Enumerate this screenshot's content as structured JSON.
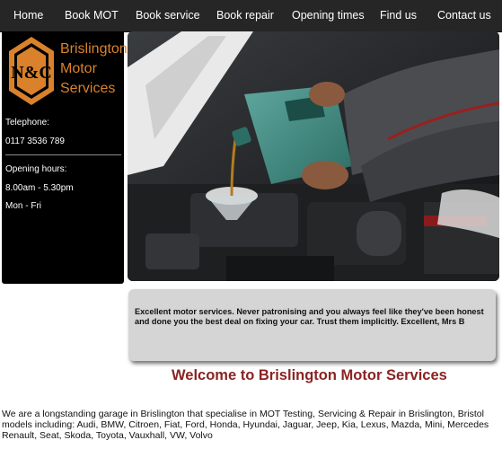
{
  "nav": {
    "items": [
      "Home",
      "Book MOT",
      "Book service",
      "Book repair",
      "Opening times",
      "Find us",
      "Contact us"
    ]
  },
  "logo": {
    "monogram": "N&C",
    "lines": [
      "Brislington",
      "Motor",
      "Services"
    ]
  },
  "sidebar": {
    "telephone_label": "Telephone:",
    "telephone_value": "0117 3536 789",
    "hours_label": "Opening hours:",
    "hours_value": "8.00am - 5.30pm",
    "days_value": "Mon - Fri"
  },
  "hero": {
    "image": "mechanic-pouring-oil-into-engine"
  },
  "testimonial": {
    "line1": "Excellent motor services. Never patronising and you always feel like they've been honest",
    "line2": "and done you the best deal on fixing your car. Trust them implicitly. Excellent, Mrs B"
  },
  "welcome": {
    "title": "Welcome to Brislington Motor Services"
  },
  "intro": {
    "line1": "We are a longstanding garage in Brislington that specialise in MOT Testing, Servicing & Repair in Brislington, Bristol",
    "line2": "models including: Audi, BMW, Citroen, Fiat, Ford, Honda, Hyundai, Jaguar, Jeep, Kia, Lexus, Mazda, Mini, Mercedes",
    "line3": "Renault, Seat, Skoda, Toyota, Vauxhall, VW, Volvo"
  },
  "colors": {
    "nav_bg": "#262626",
    "logo_orange": "#d9822b",
    "welcome_red": "#8b2323",
    "quote_bg": "#d5d5d5"
  }
}
